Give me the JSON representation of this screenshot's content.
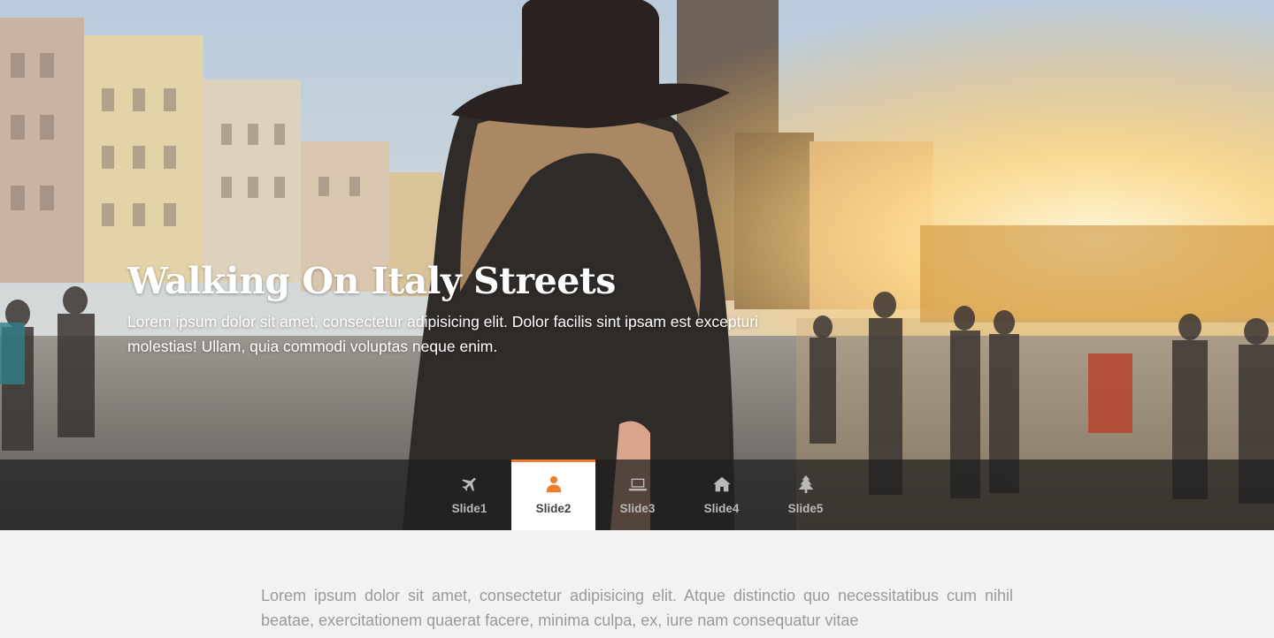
{
  "hero": {
    "title": "Walking On Italy Streets",
    "description": "Lorem ipsum dolor sit amet, consectetur adipisicing elit. Dolor facilis sint ipsam est excepturi molestias! Ullam, quia commodi voluptas neque enim."
  },
  "tabs": [
    {
      "label": "Slide1",
      "icon": "airplane-icon",
      "active": false
    },
    {
      "label": "Slide2",
      "icon": "user-icon",
      "active": true
    },
    {
      "label": "Slide3",
      "icon": "laptop-icon",
      "active": false
    },
    {
      "label": "Slide4",
      "icon": "home-icon",
      "active": false
    },
    {
      "label": "Slide5",
      "icon": "tree-icon",
      "active": false
    }
  ],
  "content": {
    "paragraph": "Lorem ipsum dolor sit amet, consectetur adipisicing elit. Atque distinctio quo necessitatibus cum nihil beatae, exercitationem quaerat facere, minima culpa, ex, iure nam consequatur vitae"
  },
  "colors": {
    "accent": "#f07d2c",
    "tab_bar": "#1e1e1e",
    "page_bg": "#f2f2f2"
  }
}
